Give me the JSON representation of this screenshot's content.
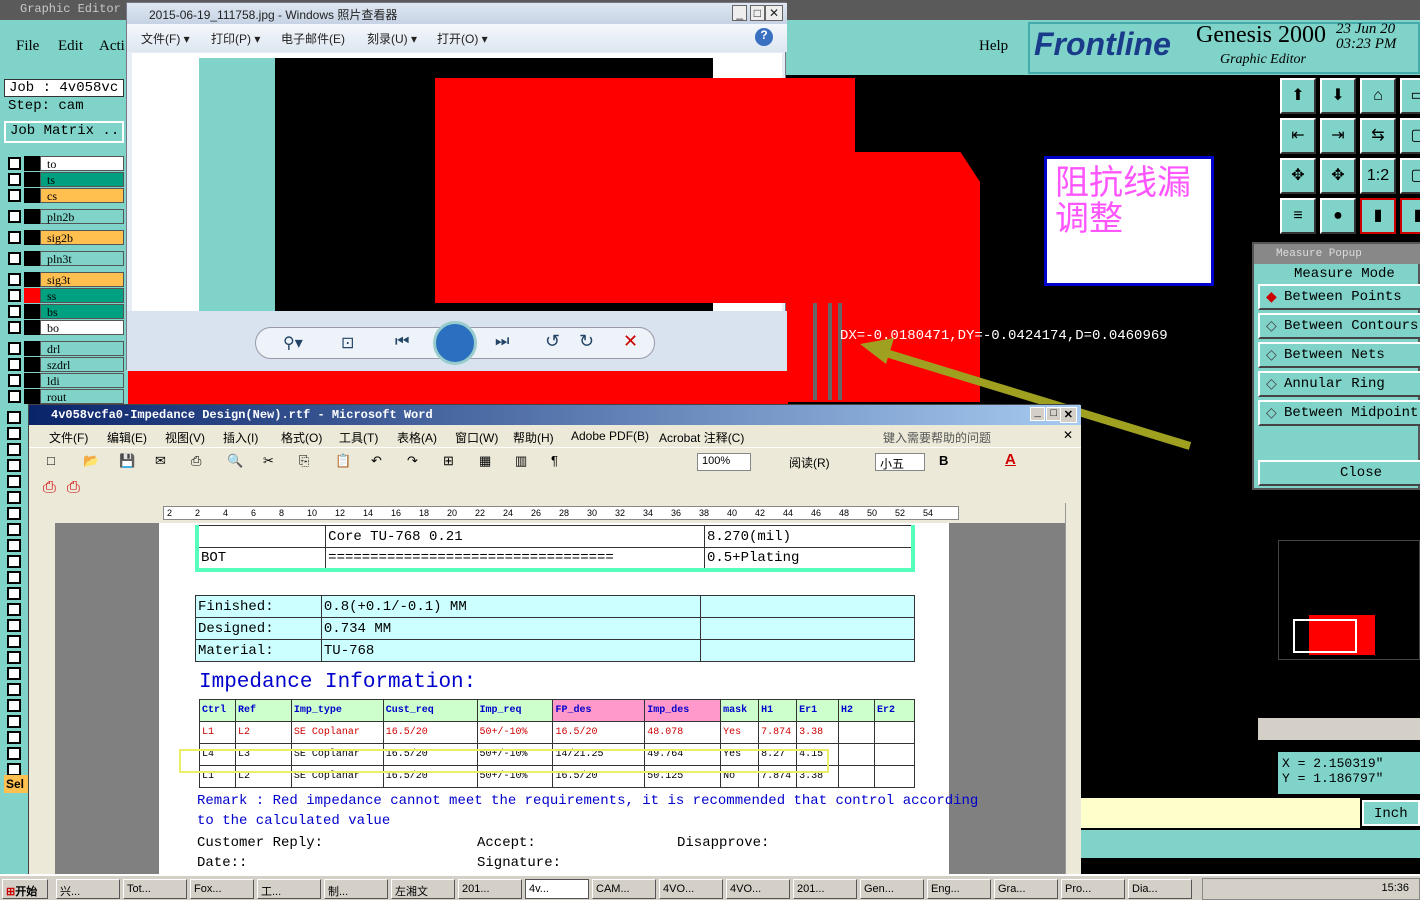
{
  "genesis": {
    "title": "Graphic Editor",
    "menu": [
      "File",
      "Edit",
      "Acti"
    ],
    "help": "Help",
    "brand": "Frontline",
    "product": "Genesis 2000",
    "subtitle": "Graphic Editor",
    "date": "23 Jun 20",
    "time": "03:23 PM",
    "job": "Job : 4v058vc",
    "step": "Step: cam",
    "job_matrix": "Job Matrix ..",
    "layers": [
      {
        "name": "to",
        "color": "#ffffff"
      },
      {
        "name": "ts",
        "color": "#00a080"
      },
      {
        "name": "cs",
        "color": "#ffc050"
      },
      {
        "name": "pln2b",
        "color": "#7fd3c8"
      },
      {
        "name": "sig2b",
        "color": "#ffc050"
      },
      {
        "name": "pln3t",
        "color": "#7fd3c8"
      },
      {
        "name": "sig3t",
        "color": "#ffc050"
      },
      {
        "name": "ss",
        "color": "#00a080"
      },
      {
        "name": "bs",
        "color": "#00a080"
      },
      {
        "name": "bo",
        "color": "#ffffff"
      },
      {
        "name": "drl",
        "color": "#7fd3c8"
      },
      {
        "name": "szdrl",
        "color": "#7fd3c8"
      },
      {
        "name": "ldi",
        "color": "#7fd3c8"
      },
      {
        "name": "rout",
        "color": "#7fd3c8"
      }
    ],
    "sel_label": "Sel",
    "measure_readout": "DX=-0.0180471,DY=-0.0424174,D=0.0460969",
    "coord_x": "X = 2.150319\"",
    "coord_y": "Y = 1.186797\"",
    "units": "Inch"
  },
  "measure_popup": {
    "title": "Measure Popup",
    "mode_label": "Measure Mode",
    "options": [
      "Between Points",
      "Between Contours",
      "Between Nets",
      "Annular Ring",
      "Between Midpoint"
    ],
    "close": "Close"
  },
  "annotation": {
    "line1": "阻抗线漏",
    "line2": "调整"
  },
  "photo_viewer": {
    "title": "2015-06-19_111758.jpg - Windows 照片查看器",
    "menu": [
      "文件(F) ▾",
      "打印(P) ▾",
      "电子邮件(E)",
      "刻录(U) ▾",
      "打开(O) ▾"
    ]
  },
  "word": {
    "title": "4v058vcfa0-Impedance Design(New).rtf - Microsoft Word",
    "menu": [
      "文件(F)",
      "编辑(E)",
      "视图(V)",
      "插入(I)",
      "格式(O)",
      "工具(T)",
      "表格(A)",
      "窗口(W)",
      "帮助(H)",
      "Adobe PDF(B)",
      "Acrobat 注释(C)"
    ],
    "help_placeholder": "键入需要帮助的问题",
    "zoom": "100%",
    "read_label": "阅读(R)",
    "font_size": "小五",
    "ruler_marks": [
      "2",
      "2",
      "4",
      "6",
      "8",
      "10",
      "12",
      "14",
      "16",
      "18",
      "20",
      "22",
      "24",
      "26",
      "28",
      "30",
      "32",
      "34",
      "36",
      "38",
      "40",
      "42",
      "44",
      "46",
      "48",
      "50",
      "52",
      "54"
    ],
    "stack_rows": [
      {
        "c1": "",
        "c2": "Core      TU-768     0.21",
        "c3": "8.270(mil)"
      },
      {
        "c1": "BOT",
        "c2": "==================================",
        "c3": "0.5+Plating"
      }
    ],
    "info_rows": [
      {
        "label": "Finished:",
        "value": "0.8(+0.1/-0.1) MM"
      },
      {
        "label": "Designed:",
        "value": "0.734 MM"
      },
      {
        "label": "Material:",
        "value": "TU-768"
      }
    ],
    "impedance_heading": "Impedance Information:",
    "imp_headers": [
      "Ctrl",
      "Ref",
      "Imp_type",
      "Cust_req",
      "Imp_req",
      "FP_des",
      "Imp_des",
      "mask",
      "H1",
      "Er1",
      "H2",
      "Er2"
    ],
    "imp_rows": [
      [
        "L1",
        "L2",
        "SE Coplanar",
        "16.5/20",
        "50+/-10%",
        "16.5/20",
        "48.078",
        "Yes",
        "7.874",
        "3.38",
        "",
        ""
      ],
      [
        "L4",
        "L3",
        "SE Coplanar",
        "16.5/20",
        "50+/-10%",
        "14/21.25",
        "49.764",
        "Yes",
        "8.27",
        "4.15",
        "",
        ""
      ],
      [
        "L1",
        "L2",
        "SE Coplanar",
        "16.5/20",
        "50+/-10%",
        "16.5/20",
        "50.125",
        "No",
        "7.874",
        "3.38",
        "",
        ""
      ]
    ],
    "remark1": "Remark : Red impedance cannot meet the requirements, it is recommended that control according",
    "remark2": "to the calculated value",
    "customer_reply": "Customer Reply:",
    "accept": "Accept:",
    "disapprove": "Disapprove:",
    "date": "Date::",
    "signature": "Signature:"
  },
  "taskbar": {
    "start": "开始",
    "items": [
      "兴...",
      "Tot...",
      "Fox...",
      "工...",
      "制...",
      "左湘文",
      "201...",
      "4v...",
      "CAM...",
      "4VO...",
      "4VO...",
      "201...",
      "Gen...",
      "Eng...",
      "Gra...",
      "Pro...",
      "Dia..."
    ],
    "clock": "15:36"
  }
}
